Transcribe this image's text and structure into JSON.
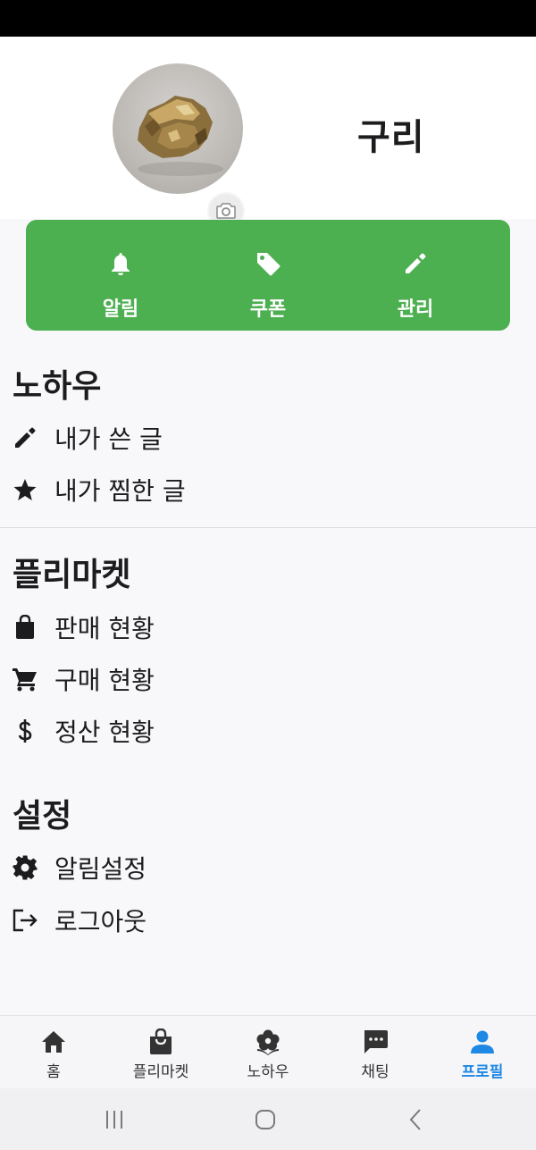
{
  "profile": {
    "name": "구리",
    "avatar_icon": "gold-nugget-photo",
    "camera_icon": "camera-icon"
  },
  "actions": [
    {
      "label": "알림",
      "icon": "bell-icon"
    },
    {
      "label": "쿠폰",
      "icon": "tag-icon"
    },
    {
      "label": "관리",
      "icon": "pencil-icon"
    }
  ],
  "sections": {
    "knowhow": {
      "title": "노하우",
      "items": [
        {
          "label": "내가 쓴 글",
          "icon": "pencil-icon"
        },
        {
          "label": "내가 찜한 글",
          "icon": "star-icon"
        }
      ]
    },
    "fleamarket": {
      "title": "플리마켓",
      "items": [
        {
          "label": "판매 현황",
          "icon": "shopping-bag-icon"
        },
        {
          "label": "구매 현황",
          "icon": "cart-icon"
        },
        {
          "label": "정산 현황",
          "icon": "dollar-icon"
        }
      ]
    },
    "settings": {
      "title": "설정",
      "items": [
        {
          "label": "알림설정",
          "icon": "gear-icon"
        },
        {
          "label": "로그아웃",
          "icon": "logout-icon"
        }
      ]
    }
  },
  "bottom_nav": [
    {
      "label": "홈",
      "icon": "home-icon",
      "active": false
    },
    {
      "label": "플리마켓",
      "icon": "shopping-bag-icon",
      "active": false
    },
    {
      "label": "노하우",
      "icon": "flower-icon",
      "active": false
    },
    {
      "label": "채팅",
      "icon": "chat-icon",
      "active": false
    },
    {
      "label": "프로필",
      "icon": "person-icon",
      "active": true
    }
  ],
  "colors": {
    "accent_green": "#4caf50",
    "active_blue": "#1e88e5",
    "text": "#1c1c1e"
  }
}
